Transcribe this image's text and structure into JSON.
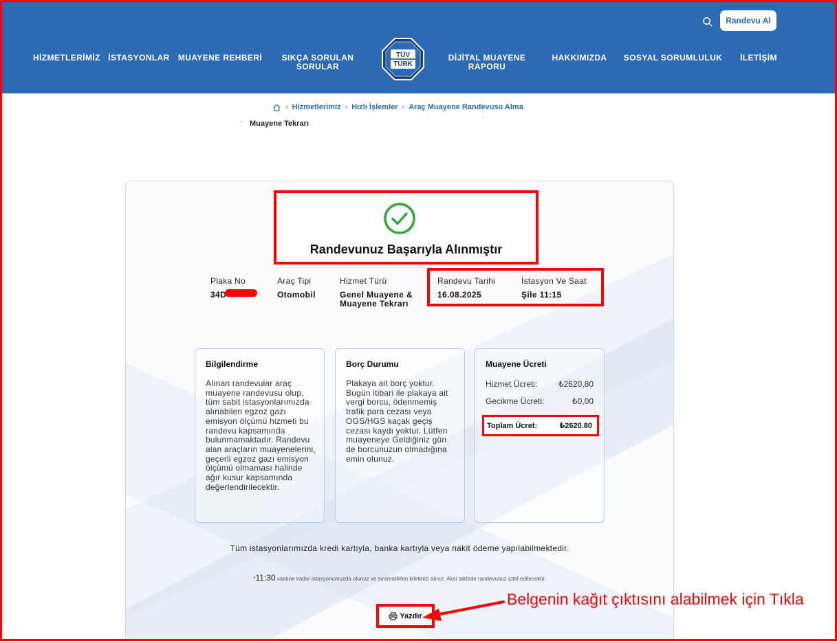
{
  "header": {
    "cta_label": "Randevu Al",
    "nav": [
      {
        "label": "HİZMETLERİMİZ"
      },
      {
        "label": "İSTASYONLAR"
      },
      {
        "label": "MUAYENE REHBERİ"
      },
      {
        "label": "SIKÇA SORULAN SORULAR"
      },
      {
        "label": "DİJİTAL MUAYENE RAPORU"
      },
      {
        "label": "HAKKIMIZDA"
      },
      {
        "label": "SOSYAL SORUMLULUK"
      },
      {
        "label": "İLETİŞİM"
      }
    ],
    "logo": {
      "line1": "TÜV",
      "line2": "TÜRK"
    }
  },
  "breadcrumb": [
    "Hizmetlerimiz",
    "Hızlı İşlemler",
    "Araç Muayene Randevusu Alma"
  ],
  "behind_text": "Muayene Tekrarı",
  "success": {
    "title": "Randevunuz Başarıyla Alınmıştır"
  },
  "details": [
    {
      "label": "Plaka No",
      "value": "34D"
    },
    {
      "label": "Araç Tipi",
      "value": "Otomobil"
    },
    {
      "label": "Hizmet Türü",
      "value": "Genel Muayene & Muayene Tekrarı"
    },
    {
      "label": "Randevu Tarihi",
      "value": "16.08.2025"
    },
    {
      "label": "İstasyon Ve Saat",
      "value": "Şile 11:15"
    }
  ],
  "cards": {
    "info": {
      "title": "Bilgilendirme",
      "text": "Alınan randevular araç muayene randevusu olup, tüm sabit istasyonlarımızda alınabilen egzoz gazı emisyon ölçümü hizmeti bu randevu kapsamında bulunmamaktadır. Randevu alan araçların muayenelerini, geçerli egzoz gazı emisyon ölçümü olmaması halinde ağır kusur kapsamında değerlendirilecektir."
    },
    "debt": {
      "title": "Borç Durumu",
      "text": "Plakaya ait borç yoktur. Bugün itibari ile plakaya ait vergi borcu, ödenmemiş trafik para cezası veya OGS/HGS kaçak geçiş cezası kaydı yoktur. Lütfen muayeneye Geldiğiniz gün de borcunuzun olmadığına emin olunuz."
    },
    "fee": {
      "title": "Muayene Ücreti",
      "service_label": "Hizmet Ücreti:",
      "service_value": "₺2620,80",
      "delay_label": "Gecikme Ücreti:",
      "delay_value": "₺0,00",
      "total_label": "Toplam Ücret:",
      "total_value": "₺2620.80"
    }
  },
  "payment_note": "Tüm istasyonlarımızda kredi kartıyla, banka kartıyla veya nakit ödeme yapılabilmektedir.",
  "time_note": {
    "prefix": "*",
    "time": "11:30",
    "text": " saatine kadar istasyonumuzda olunuz ve sıramatikten biletinizi alınız. Aksi taktirde randevunuz iptal edilecektir."
  },
  "print_label": "Yazdır",
  "annotation": "Belgenin kağıt çıktısını alabilmek için Tıkla",
  "colors": {
    "brand_blue": "#2c6ab3",
    "annotation_red": "#ff0000",
    "success_green": "#2eaa3c"
  },
  "icons": [
    "search-icon",
    "home-icon",
    "check-circle-icon",
    "printer-icon",
    "arrow-icon"
  ]
}
